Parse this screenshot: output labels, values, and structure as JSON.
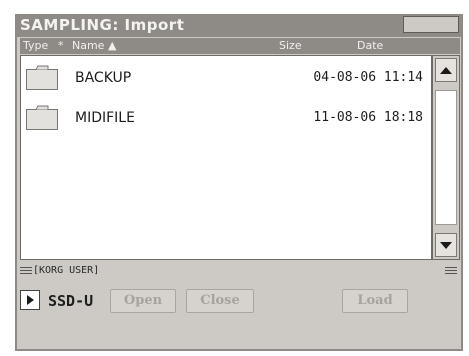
{
  "window": {
    "title": "SAMPLING: Import"
  },
  "columns": {
    "type": "Type",
    "type_sep": "*",
    "name": "Name ▲",
    "size": "Size",
    "date": "Date"
  },
  "files": [
    {
      "name": "BACKUP",
      "date": "04-08-06 11:14",
      "icon": "folder-icon"
    },
    {
      "name": "MIDIFILE",
      "date": "11-08-06 18:18",
      "icon": "folder-icon"
    }
  ],
  "path": "[KORG USER]",
  "device": {
    "label": "SSD-U"
  },
  "buttons": {
    "open": "Open",
    "close": "Close",
    "load": "Load"
  },
  "colors": {
    "titlebar": "#8e8b87",
    "panel": "#cdcac6",
    "list_bg": "#ffffff"
  }
}
